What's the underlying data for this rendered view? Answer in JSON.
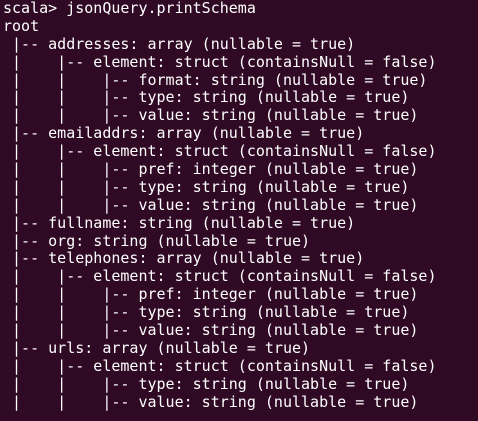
{
  "terminal": {
    "lines": [
      "scala> jsonQuery.printSchema",
      "root",
      " |-- addresses: array (nullable = true)",
      " |    |-- element: struct (containsNull = false)",
      " |    |    |-- format: string (nullable = true)",
      " |    |    |-- type: string (nullable = true)",
      " |    |    |-- value: string (nullable = true)",
      " |-- emailaddrs: array (nullable = true)",
      " |    |-- element: struct (containsNull = false)",
      " |    |    |-- pref: integer (nullable = true)",
      " |    |    |-- type: string (nullable = true)",
      " |    |    |-- value: string (nullable = true)",
      " |-- fullname: string (nullable = true)",
      " |-- org: string (nullable = true)",
      " |-- telephones: array (nullable = true)",
      " |    |-- element: struct (containsNull = false)",
      " |    |    |-- pref: integer (nullable = true)",
      " |    |    |-- type: string (nullable = true)",
      " |    |    |-- value: string (nullable = true)",
      " |-- urls: array (nullable = true)",
      " |    |-- element: struct (containsNull = false)",
      " |    |    |-- type: string (nullable = true)",
      " |    |    |-- value: string (nullable = true)"
    ],
    "colors": {
      "background": "#300a24",
      "foreground": "#ffffff"
    }
  }
}
